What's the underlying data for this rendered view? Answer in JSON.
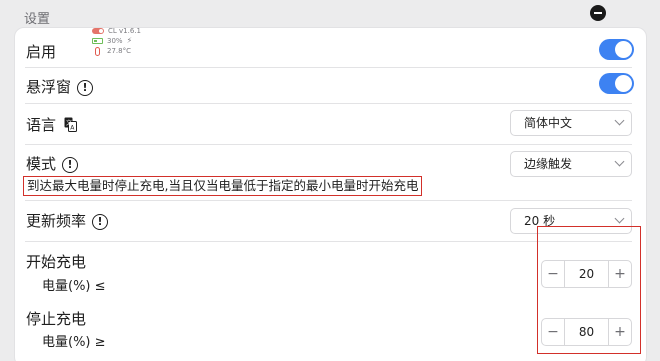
{
  "header": {
    "title": "设置"
  },
  "status_widget": {
    "version": "CL v1.6.1",
    "battery": "30%",
    "temperature": "27.8°C",
    "colors": {
      "toggle": "#e4746a",
      "battery": "#6fbf5a",
      "thermo": "#e05a4f"
    }
  },
  "settings": {
    "enable": {
      "label": "启用",
      "on": true
    },
    "floating_window": {
      "label": "悬浮窗",
      "on": true
    },
    "language": {
      "label": "语言",
      "value": "简体中文"
    },
    "mode": {
      "label": "模式",
      "value": "边缘触发",
      "hint": "到达最大电量时停止充电,当且仅当电量低于指定的最小电量时开始充电"
    },
    "update_rate": {
      "label": "更新频率",
      "value": "20 秒"
    },
    "start_charging": {
      "label": "开始充电",
      "sub_label": "电量(%) ≤",
      "value": "20"
    },
    "stop_charging": {
      "label": "停止充电",
      "sub_label": "电量(%) ≥",
      "value": "80"
    }
  },
  "stepper": {
    "minus": "−",
    "plus": "+"
  },
  "colors": {
    "accent": "#3d82f2",
    "highlight_border": "#d2302a"
  }
}
